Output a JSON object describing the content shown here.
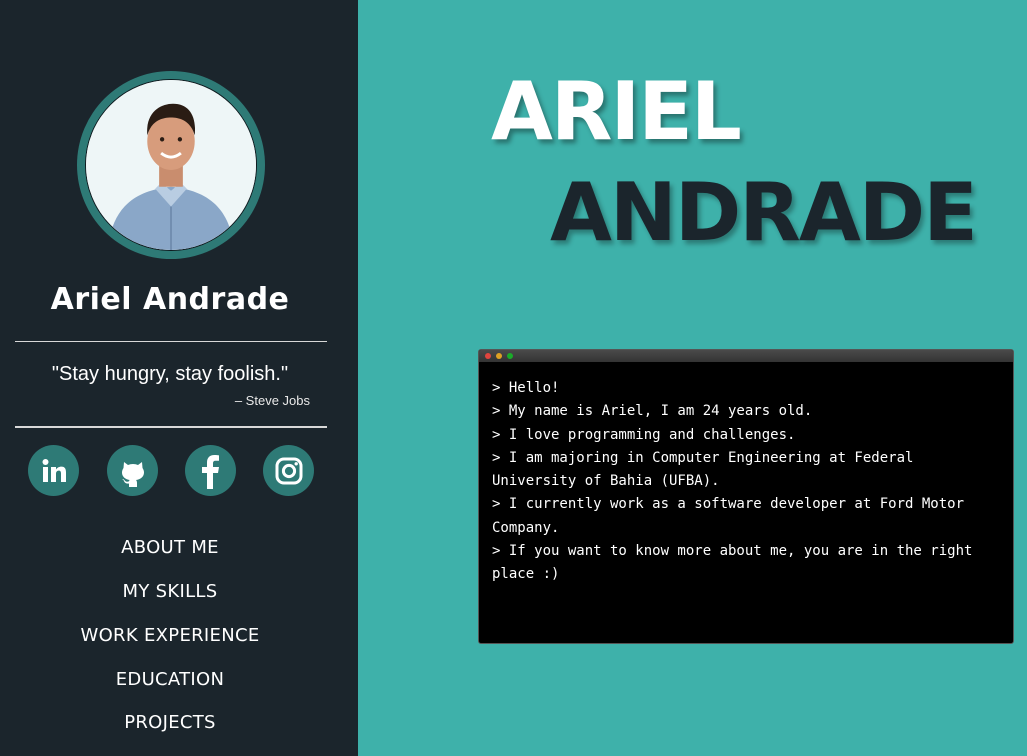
{
  "profile": {
    "name": "Ariel Andrade",
    "quote": "\"Stay hungry, stay foolish.\"",
    "quote_author": "– Steve Jobs"
  },
  "socials": [
    {
      "name": "linkedin",
      "icon": "linkedin-icon"
    },
    {
      "name": "github",
      "icon": "github-icon"
    },
    {
      "name": "facebook",
      "icon": "facebook-icon"
    },
    {
      "name": "instagram",
      "icon": "instagram-icon"
    }
  ],
  "nav": {
    "items": [
      {
        "label": "ABOUT ME"
      },
      {
        "label": "MY SKILLS"
      },
      {
        "label": "WORK EXPERIENCE"
      },
      {
        "label": "EDUCATION"
      },
      {
        "label": "PROJECTS"
      }
    ]
  },
  "hero": {
    "first_name": "ARIEL",
    "last_name": "ANDRADE"
  },
  "terminal": {
    "lines": [
      "> Hello!",
      "> My name is Ariel, I am 24 years old.",
      "> I love programming and challenges.",
      "> I am majoring in Computer Engineering at Federal University of Bahia (UFBA).",
      "> I currently work as a software developer at Ford Motor Company.",
      "> If you want to know more about me, you are in the right place :)"
    ]
  },
  "colors": {
    "sidebar_bg": "#1b252c",
    "main_bg": "#3eb1aa",
    "accent": "#2e7a76",
    "text_light": "#ffffff",
    "text_dark": "#1b252c"
  }
}
